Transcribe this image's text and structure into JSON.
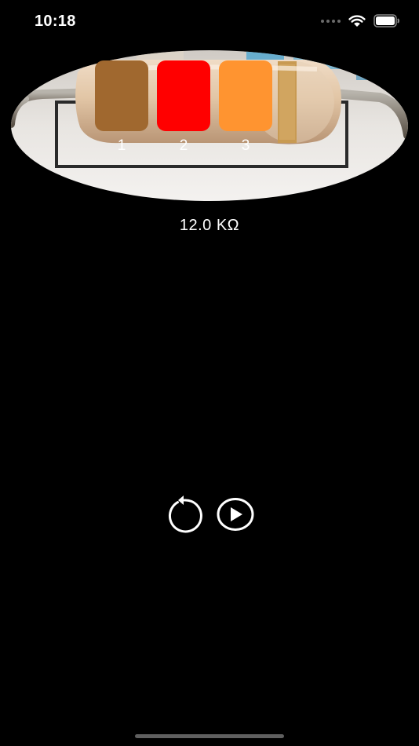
{
  "status_bar": {
    "time": "10:18",
    "icons": [
      "cellular-signal-icon",
      "wifi-icon",
      "battery-icon"
    ]
  },
  "resistor": {
    "bands": [
      {
        "label": "1",
        "color": "#A0682F"
      },
      {
        "label": "2",
        "color": "#FF0000"
      },
      {
        "label": "3",
        "color": "#FF9430"
      }
    ]
  },
  "value": {
    "text": "12.0 KΩ"
  },
  "controls": {
    "reset_icon": "reset-icon",
    "play_icon": "play-icon"
  }
}
